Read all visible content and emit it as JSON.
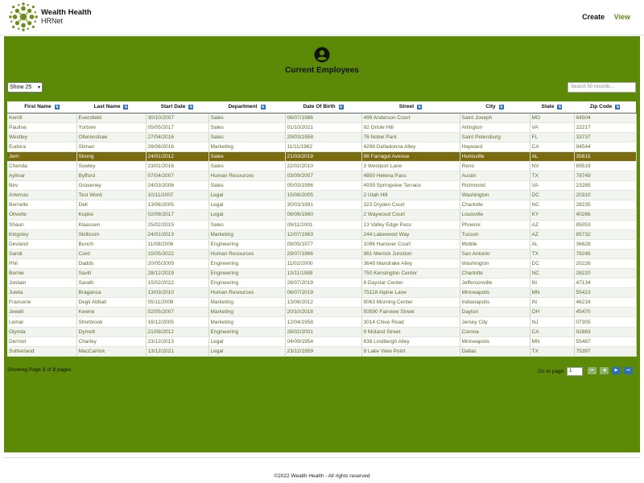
{
  "brand": {
    "name": "Wealth Health",
    "sub": "HRNet"
  },
  "nav": {
    "create": "Create",
    "view": "View"
  },
  "page": {
    "title": "Current Employees"
  },
  "controls": {
    "show": "Show 25",
    "search_placeholder": "Search 50 records..."
  },
  "columns": [
    "First Name",
    "Last Name",
    "Start Date",
    "Department",
    "Date Of Birth",
    "Street",
    "City",
    "State",
    "Zip Code"
  ],
  "rows": [
    [
      "Kerrill",
      "Eversfield",
      "30/10/2007",
      "Sales",
      "06/07/1986",
      "499 Anderson Court",
      "Saint Joseph",
      "MO",
      "64504"
    ],
    [
      "Paulina",
      "Yurtsev",
      "05/05/2017",
      "Sales",
      "01/10/2021",
      "92 Oriole Hill",
      "Arlington",
      "VA",
      "22217"
    ],
    [
      "Westley",
      "Ollerenshaw",
      "27/04/2016",
      "Sales",
      "29/03/1958",
      "76 Nobel Park",
      "Saint Petersburg",
      "FL",
      "33737"
    ],
    [
      "Eudora",
      "Sliman",
      "28/06/2016",
      "Marketing",
      "11/11/1962",
      "4296 Delladonna Alley",
      "Hayward",
      "CA",
      "94544"
    ],
    [
      "Jerri",
      "Strong",
      "24/01/2012",
      "Sales",
      "21/03/2019",
      "98 Farragut Avenue",
      "Huntsville",
      "AL",
      "35815"
    ],
    [
      "Cherida",
      "Sowley",
      "23/01/2016",
      "Sales",
      "22/02/2010",
      "3 Westport Lane",
      "Reno",
      "NV",
      "89519"
    ],
    [
      "Aylmar",
      "Byfford",
      "07/04/2007",
      "Human Resources",
      "03/09/2007",
      "4850 Helena Pass",
      "Austin",
      "TX",
      "78749"
    ],
    [
      "Bev",
      "Graveney",
      "24/03/2006",
      "Sales",
      "05/03/1996",
      "4939 Springview Terrace",
      "Richmond",
      "VA",
      "23285"
    ],
    [
      "Artemas",
      "Test Word",
      "10/11/2007",
      "Legal",
      "15/08/2005",
      "2 Utah Hill",
      "Washington",
      "DC",
      "20310"
    ],
    [
      "Bernelle",
      "Dell",
      "13/06/2005",
      "Legal",
      "30/03/1991",
      "323 Dryden Court",
      "Charlotte",
      "NC",
      "28235"
    ],
    [
      "Olivette",
      "Kopke",
      "02/08/2017",
      "Legal",
      "08/06/1960",
      "2 Waywood Court",
      "Louisville",
      "KY",
      "40266"
    ],
    [
      "Shaun",
      "Klaassen",
      "25/02/2015",
      "Sales",
      "09/11/2001",
      "13 Valley Edge Pass",
      "Phoenix",
      "AZ",
      "85053"
    ],
    [
      "Kingsley",
      "Skillicorn",
      "24/01/2013",
      "Marketing",
      "12/07/1963",
      "244 Lakewood Way",
      "Tucson",
      "AZ",
      "85732"
    ],
    [
      "Devland",
      "Bunch",
      "11/08/2006",
      "Engineering",
      "09/05/1977",
      "1096 Hanover Court",
      "Mobile",
      "AL",
      "36628"
    ],
    [
      "Sandi",
      "Cord",
      "15/05/2022",
      "Human Resources",
      "29/07/1966",
      "961 Merrick Junction",
      "San Antonio",
      "TX",
      "78245"
    ],
    [
      "Phil",
      "Dadds",
      "20/05/2005",
      "Engineering",
      "11/02/2000",
      "3649 Mandrake Alley",
      "Washington",
      "DC",
      "20226"
    ],
    [
      "Bernie",
      "Savill",
      "28/12/2019",
      "Engineering",
      "13/11/1989",
      "750 Kensington Center",
      "Charlotte",
      "NC",
      "28220"
    ],
    [
      "Jordain",
      "Sarath",
      "15/02/2022",
      "Engineering",
      "28/07/2019",
      "8 Daystar Center",
      "Jeffersonville",
      "IN",
      "47134"
    ],
    [
      "Juieta",
      "Braganca",
      "13/03/2010",
      "Human Resources",
      "08/07/2019",
      "75118 Alpine Lane",
      "Minneapolis",
      "MN",
      "55423"
    ],
    [
      "Francene",
      "Degli Abbati",
      "05/11/2008",
      "Marketing",
      "13/06/2012",
      "9063 Morning Center",
      "Indianapolis",
      "IN",
      "46216"
    ],
    [
      "Jewell",
      "Kewne",
      "02/05/2007",
      "Marketing",
      "20/10/2018",
      "50590 Fairview Street",
      "Dayton",
      "OH",
      "45470"
    ],
    [
      "Lemar",
      "Shorbrook",
      "16/12/2005",
      "Marketing",
      "12/04/1958",
      "3014 Chive Road",
      "Jersey City",
      "NJ",
      "07305"
    ],
    [
      "Glynda",
      "Dymott",
      "21/08/2012",
      "Engineering",
      "28/02/2001",
      "9 Moland Street",
      "Corona",
      "CA",
      "92883"
    ],
    [
      "Dermot",
      "Charley",
      "23/12/2013",
      "Legal",
      "04/09/1954",
      "638 Lindbergh Alley",
      "Minneapolis",
      "MN",
      "55487"
    ],
    [
      "Sutherland",
      "MacCarrick",
      "13/12/2021",
      "Legal",
      "23/12/1959",
      "9 Lake View Point",
      "Dallas",
      "TX",
      "75397"
    ]
  ],
  "selected_row": 4,
  "pagination": {
    "status_prefix": "Showing Page ",
    "current": "1",
    "of": " of ",
    "total": "2",
    "status_suffix": " pages",
    "goto_label": "Go to page",
    "goto_value": "1"
  },
  "footer": "©2022 Wealth Health - All rights reserved",
  "colors": {
    "accent": "#5c8a06",
    "selected_row": "#7a6a10",
    "pager_active": "#2e6fb6"
  }
}
